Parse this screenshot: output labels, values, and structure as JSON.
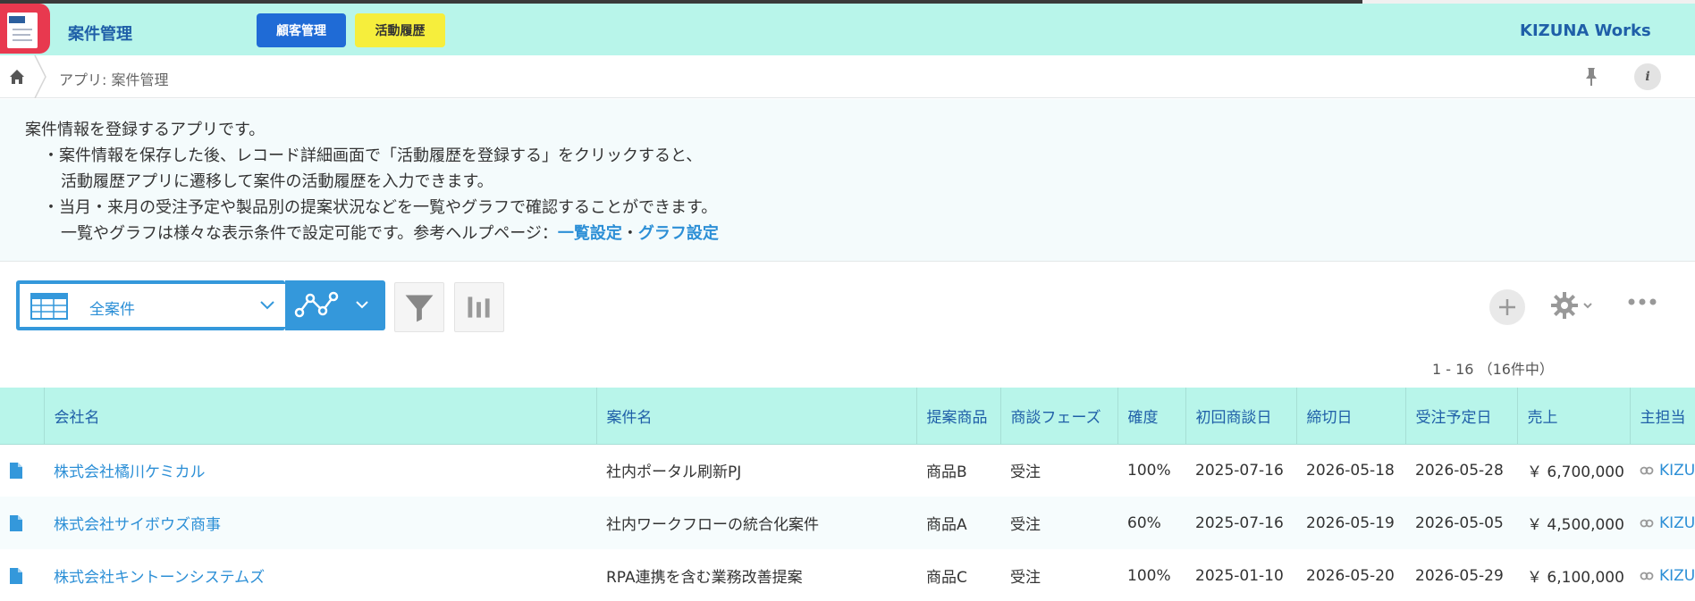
{
  "header": {
    "app_title": "案件管理",
    "button_customers": "顧客管理",
    "button_activities": "活動履歴",
    "brand": "KIZUNA Works"
  },
  "breadcrumb": {
    "current": "アプリ: 案件管理"
  },
  "description": {
    "line1": "案件情報を登録するアプリです。",
    "line2": "・案件情報を保存した後、レコード詳細画面で「活動履歴を登録する」をクリックすると、",
    "line3": "活動履歴アプリに遷移して案件の活動履歴を入力できます。",
    "line4": "・当月・来月の受注予定や製品別の提案状況などを一覧やグラフで確認することができます。",
    "line5_prefix": "一覧やグラフは様々な表示条件で設定可能です。参考ヘルプページ：",
    "link_list": "一覧設定",
    "separator": "・",
    "link_graph": "グラフ設定"
  },
  "toolbar": {
    "view_name": "全案件",
    "record_count": "1 - 16 （16件中）"
  },
  "table": {
    "headers": [
      "会社名",
      "案件名",
      "提案商品",
      "商談フェーズ",
      "確度",
      "初回商談日",
      "締切日",
      "受注予定日",
      "売上",
      "主担当"
    ],
    "rows": [
      [
        "株式会社橘川ケミカル",
        "社内ポータル刷新PJ",
        "商品B",
        "受注",
        "100%",
        "2025-07-16",
        "2026-05-18",
        "2026-05-28",
        "￥ 6,700,000",
        "KIZUNA"
      ],
      [
        "株式会社サイボウズ商事",
        "社内ワークフローの統合化案件",
        "商品A",
        "受注",
        "60%",
        "2025-07-16",
        "2026-05-19",
        "2026-05-05",
        "￥ 4,500,000",
        "KIZUNA"
      ],
      [
        "株式会社キントーンシステムズ",
        "RPA連携を含む業務改善提案",
        "商品C",
        "受注",
        "100%",
        "2025-01-10",
        "2026-05-20",
        "2026-05-29",
        "￥ 6,100,000",
        "KIZUNA"
      ]
    ]
  },
  "colors": {
    "header_bg": "#b8f5ea",
    "accent_blue": "#3498db",
    "link_blue": "#2c8fd6",
    "title_blue": "#1f5fa8",
    "app_icon_red": "#e8394f",
    "button_blue": "#1f6bd6",
    "button_yellow": "#f6ee3c"
  }
}
